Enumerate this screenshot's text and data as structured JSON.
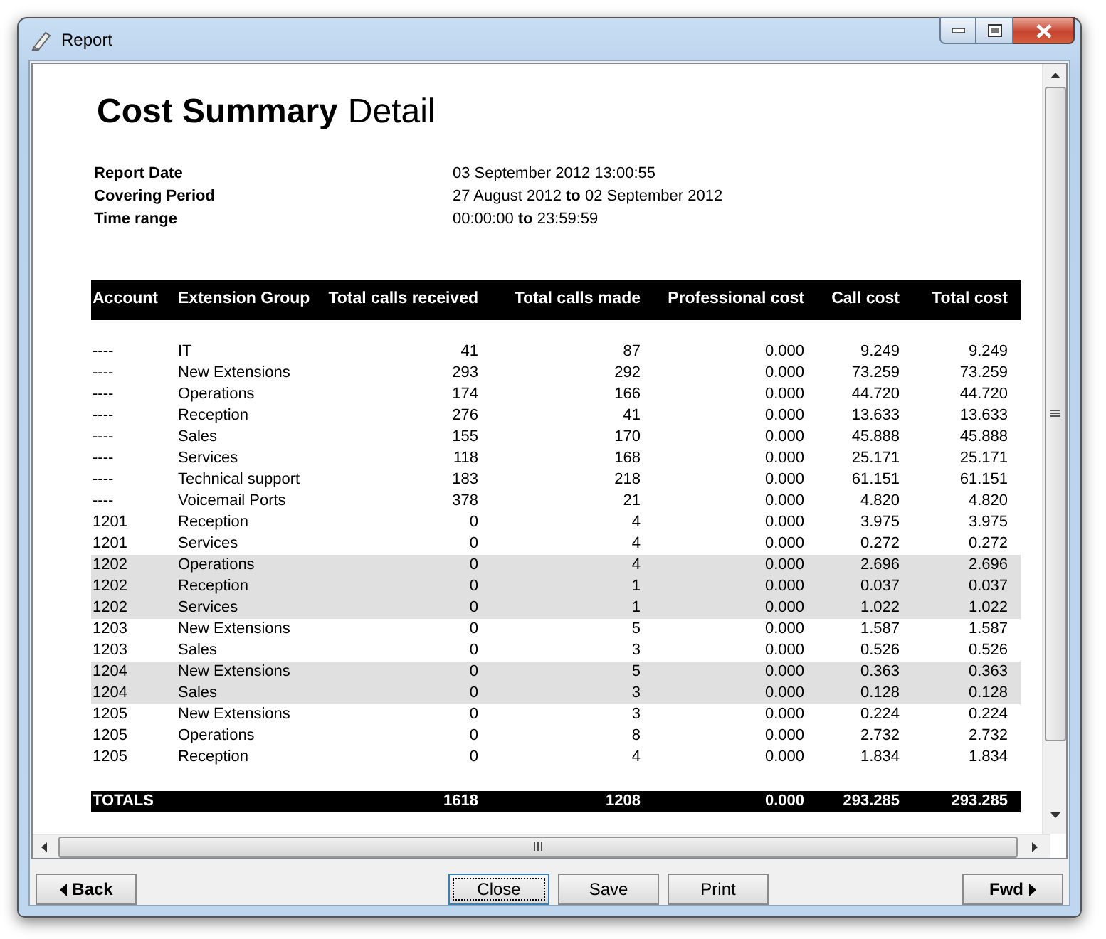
{
  "window": {
    "title": "Report"
  },
  "report": {
    "title_bold": "Cost Summary",
    "title_rest": "Detail",
    "meta": [
      {
        "label": "Report Date",
        "value": "03 September 2012 13:00:55"
      },
      {
        "label": "Covering Period",
        "value": "27 August 2012 **to** 02 September 2012"
      },
      {
        "label": "Time range",
        "value": "00:00:00 **to** 23:59:59"
      }
    ]
  },
  "table": {
    "columns": [
      "Account",
      "Extension Group",
      "Total calls received",
      "Total calls made",
      "Professional cost",
      "Call cost",
      "Total cost"
    ],
    "rows": [
      {
        "cells": [
          "----",
          "IT",
          "41",
          "87",
          "0.000",
          "9.249",
          "9.249"
        ],
        "shaded": false
      },
      {
        "cells": [
          "----",
          "New Extensions",
          "293",
          "292",
          "0.000",
          "73.259",
          "73.259"
        ],
        "shaded": false
      },
      {
        "cells": [
          "----",
          "Operations",
          "174",
          "166",
          "0.000",
          "44.720",
          "44.720"
        ],
        "shaded": false
      },
      {
        "cells": [
          "----",
          "Reception",
          "276",
          "41",
          "0.000",
          "13.633",
          "13.633"
        ],
        "shaded": false
      },
      {
        "cells": [
          "----",
          "Sales",
          "155",
          "170",
          "0.000",
          "45.888",
          "45.888"
        ],
        "shaded": false
      },
      {
        "cells": [
          "----",
          "Services",
          "118",
          "168",
          "0.000",
          "25.171",
          "25.171"
        ],
        "shaded": false
      },
      {
        "cells": [
          "----",
          "Technical support",
          "183",
          "218",
          "0.000",
          "61.151",
          "61.151"
        ],
        "shaded": false
      },
      {
        "cells": [
          "----",
          "Voicemail Ports",
          "378",
          "21",
          "0.000",
          "4.820",
          "4.820"
        ],
        "shaded": false
      },
      {
        "cells": [
          "1201",
          "Reception",
          "0",
          "4",
          "0.000",
          "3.975",
          "3.975"
        ],
        "shaded": false
      },
      {
        "cells": [
          "1201",
          "Services",
          "0",
          "4",
          "0.000",
          "0.272",
          "0.272"
        ],
        "shaded": false
      },
      {
        "cells": [
          "1202",
          "Operations",
          "0",
          "4",
          "0.000",
          "2.696",
          "2.696"
        ],
        "shaded": true
      },
      {
        "cells": [
          "1202",
          "Reception",
          "0",
          "1",
          "0.000",
          "0.037",
          "0.037"
        ],
        "shaded": true
      },
      {
        "cells": [
          "1202",
          "Services",
          "0",
          "1",
          "0.000",
          "1.022",
          "1.022"
        ],
        "shaded": true
      },
      {
        "cells": [
          "1203",
          "New Extensions",
          "0",
          "5",
          "0.000",
          "1.587",
          "1.587"
        ],
        "shaded": false
      },
      {
        "cells": [
          "1203",
          "Sales",
          "0",
          "3",
          "0.000",
          "0.526",
          "0.526"
        ],
        "shaded": false
      },
      {
        "cells": [
          "1204",
          "New Extensions",
          "0",
          "5",
          "0.000",
          "0.363",
          "0.363"
        ],
        "shaded": true
      },
      {
        "cells": [
          "1204",
          "Sales",
          "0",
          "3",
          "0.000",
          "0.128",
          "0.128"
        ],
        "shaded": true
      },
      {
        "cells": [
          "1205",
          "New Extensions",
          "0",
          "3",
          "0.000",
          "0.224",
          "0.224"
        ],
        "shaded": false
      },
      {
        "cells": [
          "1205",
          "Operations",
          "0",
          "8",
          "0.000",
          "2.732",
          "2.732"
        ],
        "shaded": false
      },
      {
        "cells": [
          "1205",
          "Reception",
          "0",
          "4",
          "0.000",
          "1.834",
          "1.834"
        ],
        "shaded": false
      }
    ],
    "totals": {
      "label": "TOTALS",
      "values": [
        "1618",
        "1208",
        "0.000",
        "293.285",
        "293.285"
      ]
    }
  },
  "buttons": {
    "back": "Back",
    "close": "Close",
    "save": "Save",
    "print": "Print",
    "fwd": "Fwd"
  },
  "scrollbar_grip": "III"
}
